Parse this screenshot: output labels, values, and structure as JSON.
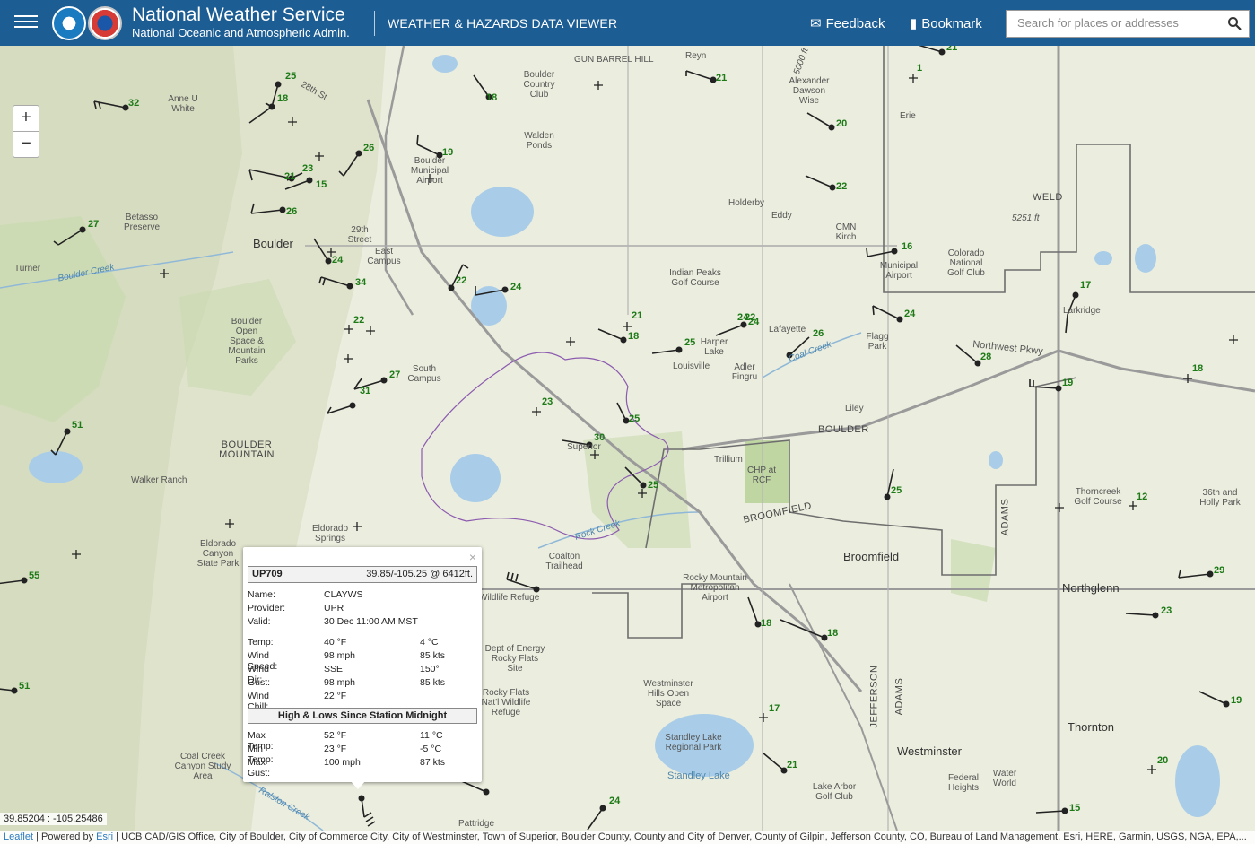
{
  "header": {
    "title": "National Weather Service",
    "subtitle": "National Oceanic and Atmospheric Admin.",
    "viewer_title": "WEATHER & HAZARDS DATA VIEWER",
    "feedback_label": "Feedback",
    "bookmark_label": "Bookmark",
    "search_placeholder": "Search for places or addresses"
  },
  "map": {
    "zoom_in": "+",
    "zoom_out": "−",
    "places": [
      {
        "id": "gun-barrel-hill",
        "text": "GUN BARREL HILL"
      },
      {
        "id": "boulder-country-club",
        "text": "Boulder Country Club"
      },
      {
        "id": "anne-u-white",
        "text": "Anne U White"
      },
      {
        "id": "walden-ponds",
        "text": "Walden Ponds"
      },
      {
        "id": "boulder-municipal-airport",
        "text": "Boulder Municipal Airport"
      },
      {
        "id": "alexander-dawson",
        "text": "Alexander Dawson Wise"
      },
      {
        "id": "erie",
        "text": "Erie"
      },
      {
        "id": "holderby",
        "text": "Holderby"
      },
      {
        "id": "eddy",
        "text": "Eddy"
      },
      {
        "id": "cmn-kirch",
        "text": "CMN Kirch"
      },
      {
        "id": "weld",
        "text": "WELD"
      },
      {
        "id": "betasso",
        "text": "Betasso Preserve"
      },
      {
        "id": "boulder",
        "text": "Boulder"
      },
      {
        "id": "29th-street",
        "text": "29th Street"
      },
      {
        "id": "east-campus",
        "text": "East Campus"
      },
      {
        "id": "turner",
        "text": "Turner"
      },
      {
        "id": "indian-peaks",
        "text": "Indian Peaks Golf Course"
      },
      {
        "id": "erie-municipal-airport",
        "text": "Municipal Airport"
      },
      {
        "id": "colorado-national-golf",
        "text": "Colorado National Golf Club"
      },
      {
        "id": "boulder-open-space",
        "text": "Boulder Open Space & Mountain Parks"
      },
      {
        "id": "lafayette",
        "text": "Lafayette"
      },
      {
        "id": "harper-lake",
        "text": "Harper Lake"
      },
      {
        "id": "louisville",
        "text": "Louisville"
      },
      {
        "id": "adler-fingru",
        "text": "Adler Fingru"
      },
      {
        "id": "flagg-park",
        "text": "Flagg Park"
      },
      {
        "id": "lalarkidge",
        "text": "Larkridge"
      },
      {
        "id": "south-campus",
        "text": "South Campus"
      },
      {
        "id": "liley",
        "text": "Liley"
      },
      {
        "id": "boulder-mountain",
        "text": "BOULDER MOUNTAIN"
      },
      {
        "id": "boulder-county",
        "text": "BOULDER"
      },
      {
        "id": "superior",
        "text": "Superior"
      },
      {
        "id": "trillium",
        "text": "Trillium"
      },
      {
        "id": "chp-rcf",
        "text": "CHP at RCF"
      },
      {
        "id": "walker-ranch",
        "text": "Walker Ranch"
      },
      {
        "id": "thorncreek",
        "text": "Thorncreek Golf Course"
      },
      {
        "id": "36th-and-holly",
        "text": "36th and Holly Park"
      },
      {
        "id": "broomfield-county",
        "text": "BROOMFIELD"
      },
      {
        "id": "eldorado-springs",
        "text": "Eldorado Springs"
      },
      {
        "id": "eldorado-canyon",
        "text": "Eldorado Canyon State Park"
      },
      {
        "id": "broomfield",
        "text": "Broomfield"
      },
      {
        "id": "coalton-trailhead",
        "text": "Coalton Trailhead"
      },
      {
        "id": "adams",
        "text": "ADAMS"
      },
      {
        "id": "rocky-mountain-airport",
        "text": "Rocky Mountain Metropolitan Airport"
      },
      {
        "id": "northglenn",
        "text": "Northglenn"
      },
      {
        "id": "wildlife-refuge",
        "text": "Wildlife Refuge"
      },
      {
        "id": "dept-energy",
        "text": "Dept of Energy Rocky Flats Site"
      },
      {
        "id": "rocky-flats-refuge",
        "text": "Rocky Flats Nat'l Wildlife Refuge"
      },
      {
        "id": "westminster-hills",
        "text": "Westminster Hills Open Space"
      },
      {
        "id": "jefferson",
        "text": "JEFFERSON"
      },
      {
        "id": "adams2",
        "text": "ADAMS"
      },
      {
        "id": "standley-park",
        "text": "Standley Lake Regional Park"
      },
      {
        "id": "standley-lake",
        "text": "Standley Lake"
      },
      {
        "id": "westminster",
        "text": "Westminster"
      },
      {
        "id": "thornton",
        "text": "Thornton"
      },
      {
        "id": "federal-heights",
        "text": "Federal Heights"
      },
      {
        "id": "water-world",
        "text": "Water World"
      },
      {
        "id": "coal-creek-canyon",
        "text": "Coal Creek Canyon Study Area"
      },
      {
        "id": "lake-arbor",
        "text": "Lake Arbor Golf Club"
      },
      {
        "id": "pattridge",
        "text": "Pattridge"
      },
      {
        "id": "reyn",
        "text": "Reyn"
      },
      {
        "id": "city-boulder",
        "text": "BOULDER"
      }
    ],
    "water_labels": [
      {
        "id": "boulder-creek",
        "text": "Boulder Creek"
      },
      {
        "id": "coal-creek",
        "text": "Coal Creek"
      },
      {
        "id": "rock-creek",
        "text": "Rock Creek"
      },
      {
        "id": "ralston-creek",
        "text": "Ralston Creek"
      },
      {
        "id": "northwest-pkwy",
        "text": "Northwest Pkwy"
      },
      {
        "id": "28th-st",
        "text": "28th St"
      },
      {
        "id": "5251ft",
        "text": "5251 ft"
      },
      {
        "id": "5000ft",
        "text": "5000 ft"
      }
    ],
    "stations": [
      {
        "v": "25"
      },
      {
        "v": "18"
      },
      {
        "v": "32"
      },
      {
        "v": "18"
      },
      {
        "v": "21"
      },
      {
        "v": "1"
      },
      {
        "v": "21"
      },
      {
        "v": "19"
      },
      {
        "v": "26"
      },
      {
        "v": "20"
      },
      {
        "v": "23"
      },
      {
        "v": "21"
      },
      {
        "v": "15"
      },
      {
        "v": "26"
      },
      {
        "v": "22"
      },
      {
        "v": "27"
      },
      {
        "v": "24"
      },
      {
        "v": "16"
      },
      {
        "v": "34"
      },
      {
        "v": "22"
      },
      {
        "v": "24"
      },
      {
        "v": "17"
      },
      {
        "v": "22"
      },
      {
        "v": "21"
      },
      {
        "v": "24"
      },
      {
        "v": "18"
      },
      {
        "v": "22"
      },
      {
        "v": "24"
      },
      {
        "v": "25"
      },
      {
        "v": "26"
      },
      {
        "v": "24"
      },
      {
        "v": "28"
      },
      {
        "v": "27"
      },
      {
        "v": "31"
      },
      {
        "v": "19"
      },
      {
        "v": "18"
      },
      {
        "v": "51"
      },
      {
        "v": "23"
      },
      {
        "v": "25"
      },
      {
        "v": "30"
      },
      {
        "v": "25"
      },
      {
        "v": "25"
      },
      {
        "v": "12"
      },
      {
        "v": "55"
      },
      {
        "v": "29"
      },
      {
        "v": "18"
      },
      {
        "v": "18"
      },
      {
        "v": "23"
      },
      {
        "v": "51"
      },
      {
        "v": "17"
      },
      {
        "v": "19"
      },
      {
        "v": "21"
      },
      {
        "v": "20"
      },
      {
        "v": "24"
      },
      {
        "v": "15"
      }
    ]
  },
  "popup": {
    "close": "×",
    "station_id": "UP709",
    "location": "39.85/-105.25 @ 6412ft.",
    "info": [
      {
        "label": "Name:",
        "value": "CLAYWS"
      },
      {
        "label": "Provider:",
        "value": "UPR"
      },
      {
        "label": "Valid:",
        "value": "30 Dec 11:00 AM MST"
      }
    ],
    "obs": [
      {
        "label": "Temp:",
        "v1": "40 °F",
        "v2": "4 °C"
      },
      {
        "label": "Wind Speed:",
        "v1": "98 mph",
        "v2": "85 kts"
      },
      {
        "label": "Wind Dir:",
        "v1": "SSE",
        "v2": "150°"
      },
      {
        "label": "Gust:",
        "v1": "98 mph",
        "v2": "85 kts"
      },
      {
        "label": "Wind Chill:",
        "v1": "22 °F",
        "v2": ""
      }
    ],
    "hilo_title": "High & Lows Since Station Midnight",
    "hilo": [
      {
        "label": "Max Temp:",
        "v1": "52 °F",
        "v2": "11 °C"
      },
      {
        "label": "Min Temp:",
        "v1": "23 °F",
        "v2": "-5 °C"
      },
      {
        "label": "Max Gust:",
        "v1": "100 mph",
        "v2": "87 kts"
      }
    ]
  },
  "coords": "39.85204 : -105.25486",
  "attribution": {
    "leaflet": "Leaflet",
    "powered": " | Powered by ",
    "esri": "Esri",
    "rest": " | UCB CAD/GIS Office, City of Boulder, City of Commerce City, City of Westminster, Town of Superior, Boulder County, County and City of Denver, County of Gilpin, Jefferson County, CO, Bureau of Land Management, Esri, HERE, Garmin, USGS, NGA, EPA,..."
  },
  "colors": {
    "header": "#1c5d94",
    "station_text": "#1d7a17",
    "water": "#a9cde8",
    "forest": "#c9dbb0",
    "road": "#8d8d8d",
    "boundary": "#6e6e6e"
  }
}
